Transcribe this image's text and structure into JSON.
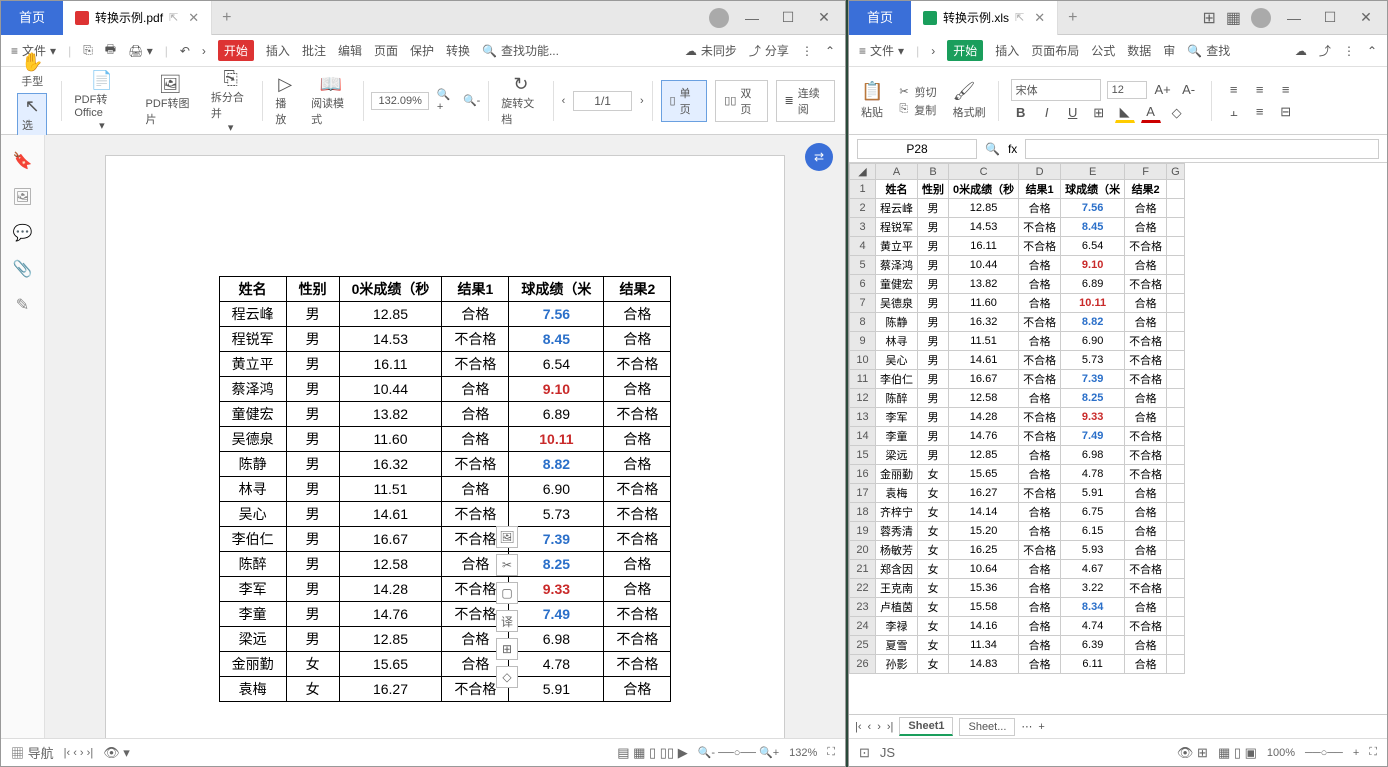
{
  "app_left": {
    "home_tab": "首页",
    "tab_name": "转换示例.pdf",
    "tab_pin": "⇱",
    "menu": {
      "file": "文件",
      "start": "开始",
      "insert": "插入",
      "annotate": "批注",
      "edit": "编辑",
      "page": "页面",
      "protect": "保护",
      "convert": "转换",
      "search": "查找功能...",
      "sync": "未同步",
      "share": "分享"
    },
    "tools": {
      "hand": "手型",
      "select": "选择",
      "to_office": "PDF转Office",
      "to_img": "PDF转图片",
      "split": "拆分合并",
      "play": "播放",
      "read": "阅读模式",
      "zoom": "132.09%",
      "rotate": "旋转文档",
      "single": "单页",
      "double": "双页",
      "continuous": "连续阅",
      "page_nav": "1/1"
    },
    "status": {
      "nav": "导航",
      "zoom": "132%"
    }
  },
  "app_right": {
    "home_tab": "首页",
    "tab_name": "转换示例.xls",
    "menu": {
      "file": "文件",
      "start": "开始",
      "insert": "插入",
      "layout": "页面布局",
      "formula": "公式",
      "data": "数据",
      "review": "审",
      "search": "查找"
    },
    "tools": {
      "paste": "粘贴",
      "cut": "剪切",
      "copy": "复制",
      "format": "格式刷",
      "font": "宋体",
      "size": "12"
    },
    "cell_name": "P28",
    "fx": "fx",
    "sheet1": "Sheet1",
    "sheet2": "Sheet...",
    "zoom": "100%"
  },
  "headers": {
    "name": "姓名",
    "gender": "性别",
    "run": "0米成绩（秒",
    "res1": "结果1",
    "ball": "球成绩（米",
    "res2": "结果2"
  },
  "xls_headers": {
    "run": "0米成绩（秒",
    "ball": "球成绩（米"
  },
  "pdf_rows": [
    {
      "n": "程云峰",
      "g": "男",
      "r": "12.85",
      "r1": "合格",
      "b": "7.56",
      "bc": "blue",
      "r2": "合格"
    },
    {
      "n": "程锐军",
      "g": "男",
      "r": "14.53",
      "r1": "不合格",
      "b": "8.45",
      "bc": "blue",
      "r2": "合格"
    },
    {
      "n": "黄立平",
      "g": "男",
      "r": "16.11",
      "r1": "不合格",
      "b": "6.54",
      "bc": "",
      "r2": "不合格"
    },
    {
      "n": "蔡泽鸿",
      "g": "男",
      "r": "10.44",
      "r1": "合格",
      "b": "9.10",
      "bc": "red",
      "r2": "合格"
    },
    {
      "n": "童健宏",
      "g": "男",
      "r": "13.82",
      "r1": "合格",
      "b": "6.89",
      "bc": "",
      "r2": "不合格"
    },
    {
      "n": "吴德泉",
      "g": "男",
      "r": "11.60",
      "r1": "合格",
      "b": "10.11",
      "bc": "red",
      "r2": "合格"
    },
    {
      "n": "陈静",
      "g": "男",
      "r": "16.32",
      "r1": "不合格",
      "b": "8.82",
      "bc": "blue",
      "r2": "合格"
    },
    {
      "n": "林寻",
      "g": "男",
      "r": "11.51",
      "r1": "合格",
      "b": "6.90",
      "bc": "",
      "r2": "不合格"
    },
    {
      "n": "吴心",
      "g": "男",
      "r": "14.61",
      "r1": "不合格",
      "b": "5.73",
      "bc": "",
      "r2": "不合格"
    },
    {
      "n": "李伯仁",
      "g": "男",
      "r": "16.67",
      "r1": "不合格",
      "b": "7.39",
      "bc": "blue",
      "r2": "不合格"
    },
    {
      "n": "陈醉",
      "g": "男",
      "r": "12.58",
      "r1": "合格",
      "b": "8.25",
      "bc": "blue",
      "r2": "合格"
    },
    {
      "n": "李军",
      "g": "男",
      "r": "14.28",
      "r1": "不合格",
      "b": "9.33",
      "bc": "red",
      "r2": "合格"
    },
    {
      "n": "李童",
      "g": "男",
      "r": "14.76",
      "r1": "不合格",
      "b": "7.49",
      "bc": "blue",
      "r2": "不合格"
    },
    {
      "n": "梁远",
      "g": "男",
      "r": "12.85",
      "r1": "合格",
      "b": "6.98",
      "bc": "",
      "r2": "不合格"
    },
    {
      "n": "金丽勤",
      "g": "女",
      "r": "15.65",
      "r1": "合格",
      "b": "4.78",
      "bc": "",
      "r2": "不合格"
    },
    {
      "n": "袁梅",
      "g": "女",
      "r": "16.27",
      "r1": "不合格",
      "b": "5.91",
      "bc": "",
      "r2": "合格"
    }
  ],
  "xls_rows": [
    {
      "n": "程云峰",
      "g": "男",
      "r": "12.85",
      "r1": "合格",
      "b": "7.56",
      "bc": "blue",
      "r2": "合格"
    },
    {
      "n": "程锐军",
      "g": "男",
      "r": "14.53",
      "r1": "不合格",
      "b": "8.45",
      "bc": "blue",
      "r2": "合格"
    },
    {
      "n": "黄立平",
      "g": "男",
      "r": "16.11",
      "r1": "不合格",
      "b": "6.54",
      "bc": "",
      "r2": "不合格"
    },
    {
      "n": "蔡泽鸿",
      "g": "男",
      "r": "10.44",
      "r1": "合格",
      "b": "9.10",
      "bc": "red",
      "r2": "合格"
    },
    {
      "n": "童健宏",
      "g": "男",
      "r": "13.82",
      "r1": "合格",
      "b": "6.89",
      "bc": "",
      "r2": "不合格"
    },
    {
      "n": "吴德泉",
      "g": "男",
      "r": "11.60",
      "r1": "合格",
      "b": "10.11",
      "bc": "red",
      "r2": "合格"
    },
    {
      "n": "陈静",
      "g": "男",
      "r": "16.32",
      "r1": "不合格",
      "b": "8.82",
      "bc": "blue",
      "r2": "合格"
    },
    {
      "n": "林寻",
      "g": "男",
      "r": "11.51",
      "r1": "合格",
      "b": "6.90",
      "bc": "",
      "r2": "不合格"
    },
    {
      "n": "吴心",
      "g": "男",
      "r": "14.61",
      "r1": "不合格",
      "b": "5.73",
      "bc": "",
      "r2": "不合格"
    },
    {
      "n": "李伯仁",
      "g": "男",
      "r": "16.67",
      "r1": "不合格",
      "b": "7.39",
      "bc": "blue",
      "r2": "不合格"
    },
    {
      "n": "陈醉",
      "g": "男",
      "r": "12.58",
      "r1": "合格",
      "b": "8.25",
      "bc": "blue",
      "r2": "合格"
    },
    {
      "n": "李军",
      "g": "男",
      "r": "14.28",
      "r1": "不合格",
      "b": "9.33",
      "bc": "red",
      "r2": "合格"
    },
    {
      "n": "李童",
      "g": "男",
      "r": "14.76",
      "r1": "不合格",
      "b": "7.49",
      "bc": "blue",
      "r2": "不合格"
    },
    {
      "n": "梁远",
      "g": "男",
      "r": "12.85",
      "r1": "合格",
      "b": "6.98",
      "bc": "",
      "r2": "不合格"
    },
    {
      "n": "金丽勤",
      "g": "女",
      "r": "15.65",
      "r1": "合格",
      "b": "4.78",
      "bc": "",
      "r2": "不合格"
    },
    {
      "n": "袁梅",
      "g": "女",
      "r": "16.27",
      "r1": "不合格",
      "b": "5.91",
      "bc": "",
      "r2": "合格"
    },
    {
      "n": "齐梓宁",
      "g": "女",
      "r": "14.14",
      "r1": "合格",
      "b": "6.75",
      "bc": "",
      "r2": "合格"
    },
    {
      "n": "蓉秀清",
      "g": "女",
      "r": "15.20",
      "r1": "合格",
      "b": "6.15",
      "bc": "",
      "r2": "合格"
    },
    {
      "n": "杨敏芳",
      "g": "女",
      "r": "16.25",
      "r1": "不合格",
      "b": "5.93",
      "bc": "",
      "r2": "合格"
    },
    {
      "n": "郑含因",
      "g": "女",
      "r": "10.64",
      "r1": "合格",
      "b": "4.67",
      "bc": "",
      "r2": "不合格"
    },
    {
      "n": "王克南",
      "g": "女",
      "r": "15.36",
      "r1": "合格",
      "b": "3.22",
      "bc": "",
      "r2": "不合格"
    },
    {
      "n": "卢植茵",
      "g": "女",
      "r": "15.58",
      "r1": "合格",
      "b": "8.34",
      "bc": "blue",
      "r2": "合格"
    },
    {
      "n": "李禄",
      "g": "女",
      "r": "14.16",
      "r1": "合格",
      "b": "4.74",
      "bc": "",
      "r2": "不合格"
    },
    {
      "n": "夏雪",
      "g": "女",
      "r": "11.34",
      "r1": "合格",
      "b": "6.39",
      "bc": "",
      "r2": "合格"
    },
    {
      "n": "孙影",
      "g": "女",
      "r": "14.83",
      "r1": "合格",
      "b": "6.11",
      "bc": "",
      "r2": "合格"
    }
  ]
}
